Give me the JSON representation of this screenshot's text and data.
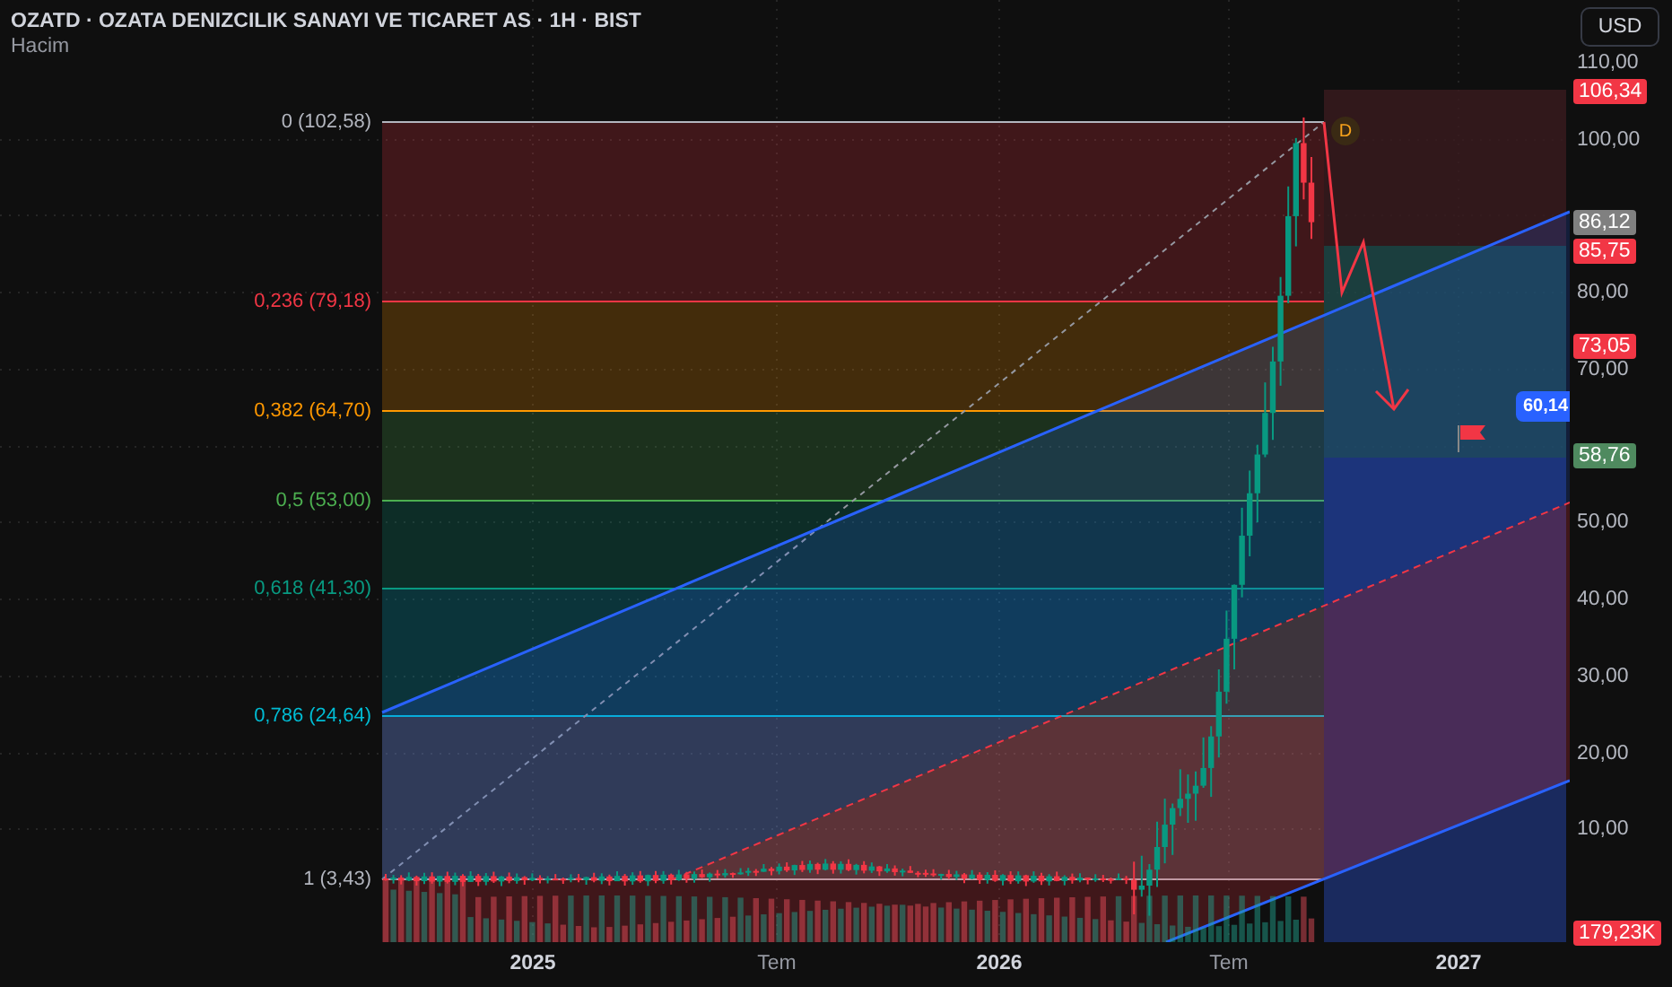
{
  "header": {
    "title": "OZATD · OZATA DENIZCILIK SANAYI VE TICARET AS · 1H · BIST",
    "indicator": "Hacim"
  },
  "currency_button": "USD",
  "fib_levels": [
    {
      "label": "0 (102,58)",
      "color": "#b2b5be"
    },
    {
      "label": "0,236 (79,18)",
      "color": "#f23645"
    },
    {
      "label": "0,382 (64,70)",
      "color": "#ff9800"
    },
    {
      "label": "0,5 (53,00)",
      "color": "#4caf50"
    },
    {
      "label": "0,618 (41,30)",
      "color": "#089981"
    },
    {
      "label": "0,786 (24,64)",
      "color": "#00bcd4"
    },
    {
      "label": "1 (3,43)",
      "color": "#b2b5be"
    }
  ],
  "marker": "D",
  "callout": "60,14",
  "price_axis": {
    "ticks": [
      "110,00",
      "100,00",
      "80,00",
      "70,00",
      "50,00",
      "40,00",
      "30,00",
      "20,00",
      "10,00"
    ],
    "tags": [
      {
        "text": "106,34",
        "color": "#f23645"
      },
      {
        "text": "86,12",
        "color": "#808080"
      },
      {
        "text": "85,75",
        "color": "#f23645"
      },
      {
        "text": "73,05",
        "color": "#f23645"
      },
      {
        "text": "58,76",
        "color": "#4f8a5f"
      },
      {
        "text": "179,23K",
        "color": "#f23645"
      }
    ]
  },
  "time_axis": [
    {
      "label": "2025",
      "kind": "year"
    },
    {
      "label": "Tem",
      "kind": "month"
    },
    {
      "label": "2026",
      "kind": "year"
    },
    {
      "label": "Tem",
      "kind": "month"
    },
    {
      "label": "2027",
      "kind": "year"
    }
  ]
}
